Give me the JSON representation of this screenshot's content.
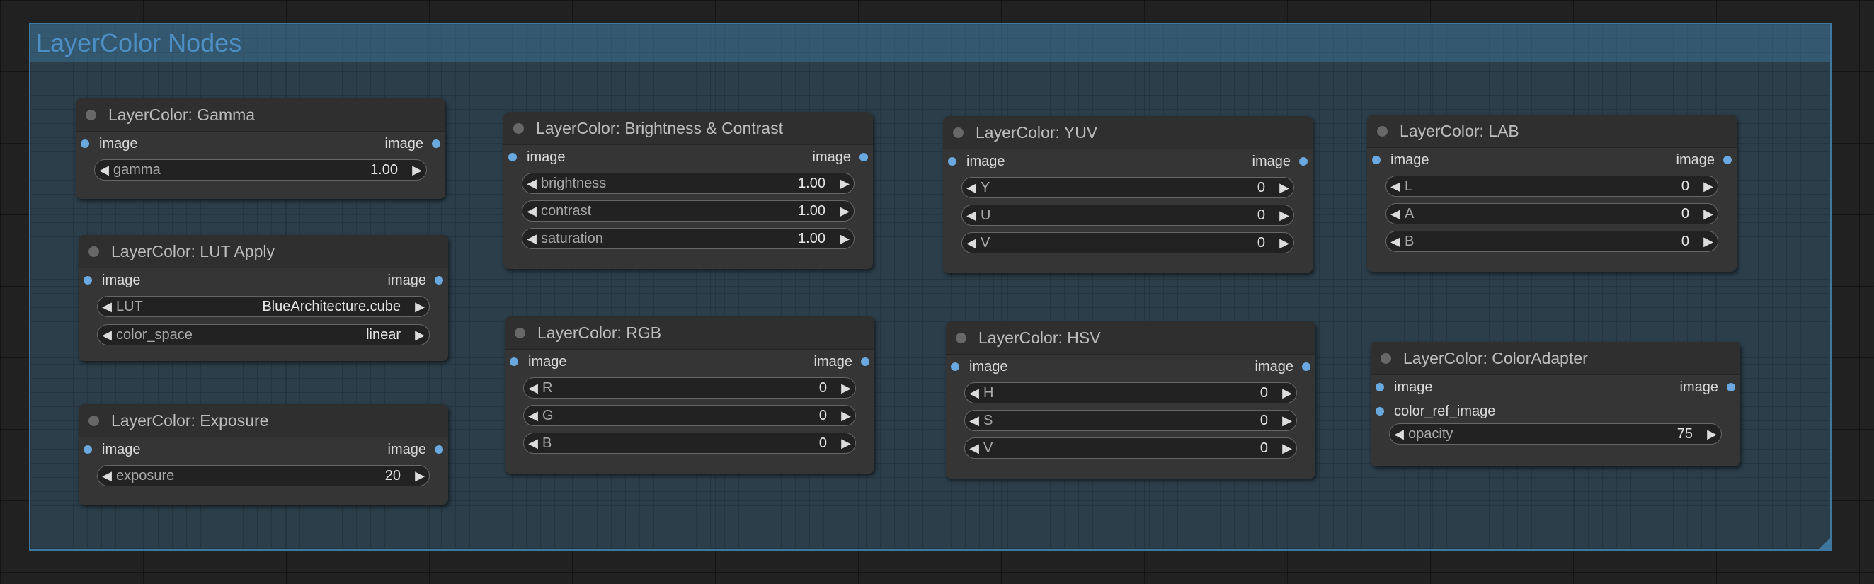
{
  "group": {
    "title": "LayerColor Nodes"
  },
  "nodes": [
    {
      "title": "LayerColor: Gamma",
      "inputs": [
        "image"
      ],
      "output": "image",
      "widgets": [
        {
          "label": "gamma",
          "value": "1.00"
        }
      ]
    },
    {
      "title": "LayerColor: LUT Apply",
      "inputs": [
        "image"
      ],
      "output": "image",
      "widgets": [
        {
          "label": "LUT",
          "value": "BlueArchitecture.cube"
        },
        {
          "label": "color_space",
          "value": "linear"
        }
      ]
    },
    {
      "title": "LayerColor: Exposure",
      "inputs": [
        "image"
      ],
      "output": "image",
      "widgets": [
        {
          "label": "exposure",
          "value": "20"
        }
      ]
    },
    {
      "title": "LayerColor: Brightness & Contrast",
      "inputs": [
        "image"
      ],
      "output": "image",
      "widgets": [
        {
          "label": "brightness",
          "value": "1.00"
        },
        {
          "label": "contrast",
          "value": "1.00"
        },
        {
          "label": "saturation",
          "value": "1.00"
        }
      ]
    },
    {
      "title": "LayerColor: RGB",
      "inputs": [
        "image"
      ],
      "output": "image",
      "widgets": [
        {
          "label": "R",
          "value": "0"
        },
        {
          "label": "G",
          "value": "0"
        },
        {
          "label": "B",
          "value": "0"
        }
      ]
    },
    {
      "title": "LayerColor: YUV",
      "inputs": [
        "image"
      ],
      "output": "image",
      "widgets": [
        {
          "label": "Y",
          "value": "0"
        },
        {
          "label": "U",
          "value": "0"
        },
        {
          "label": "V",
          "value": "0"
        }
      ]
    },
    {
      "title": "LayerColor: HSV",
      "inputs": [
        "image"
      ],
      "output": "image",
      "widgets": [
        {
          "label": "H",
          "value": "0"
        },
        {
          "label": "S",
          "value": "0"
        },
        {
          "label": "V",
          "value": "0"
        }
      ]
    },
    {
      "title": "LayerColor: LAB",
      "inputs": [
        "image"
      ],
      "output": "image",
      "widgets": [
        {
          "label": "L",
          "value": "0"
        },
        {
          "label": "A",
          "value": "0"
        },
        {
          "label": "B",
          "value": "0"
        }
      ]
    },
    {
      "title": "LayerColor: ColorAdapter",
      "inputs": [
        "image",
        "color_ref_image"
      ],
      "output": "image",
      "widgets": [
        {
          "label": "opacity",
          "value": "75"
        }
      ]
    }
  ],
  "icons": {
    "decrement": "left-triangle-icon",
    "increment": "right-triangle-icon"
  },
  "colors": {
    "group_border": "#3f789e",
    "group_title": "#4d8fc4",
    "slot": "#6aa9e0",
    "node_bg": "#353535"
  }
}
